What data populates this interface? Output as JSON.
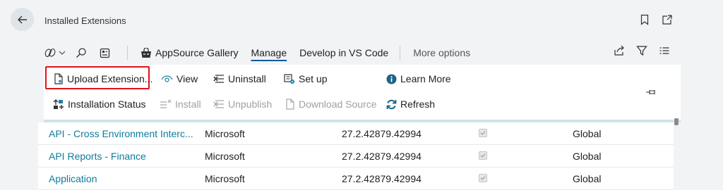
{
  "header": {
    "title": "Installed Extensions",
    "back_icon": "arrow-left-icon",
    "bookmark_icon": "bookmark-icon",
    "popout_icon": "open-in-new-window-icon"
  },
  "commandbar": {
    "items": [
      {
        "label": "AppSource Gallery",
        "icon": "appsource-icon"
      },
      {
        "label": "Manage",
        "active": true
      },
      {
        "label": "Develop in VS Code"
      },
      {
        "label": "More options"
      }
    ]
  },
  "actions": {
    "upload": "Upload Extension...",
    "view": "View",
    "uninstall": "Uninstall",
    "setup": "Set up",
    "learn_more": "Learn More",
    "installation_status": "Installation Status",
    "install": "Install",
    "unpublish": "Unpublish",
    "download_source": "Download Source",
    "refresh": "Refresh"
  },
  "table": {
    "rows": [
      {
        "name": "API - Cross Environment Interc...",
        "publisher": "Microsoft",
        "version": "27.2.42879.42994",
        "checked": true,
        "scope": "Global"
      },
      {
        "name": "API Reports - Finance",
        "publisher": "Microsoft",
        "version": "27.2.42879.42994",
        "checked": true,
        "scope": "Global"
      },
      {
        "name": "Application",
        "publisher": "Microsoft",
        "version": "27.2.42879.42994",
        "checked": true,
        "scope": "Global"
      }
    ]
  },
  "colors": {
    "accent": "#0e7c9b",
    "highlight": "#e3111b",
    "background": "#f1f3f5"
  }
}
